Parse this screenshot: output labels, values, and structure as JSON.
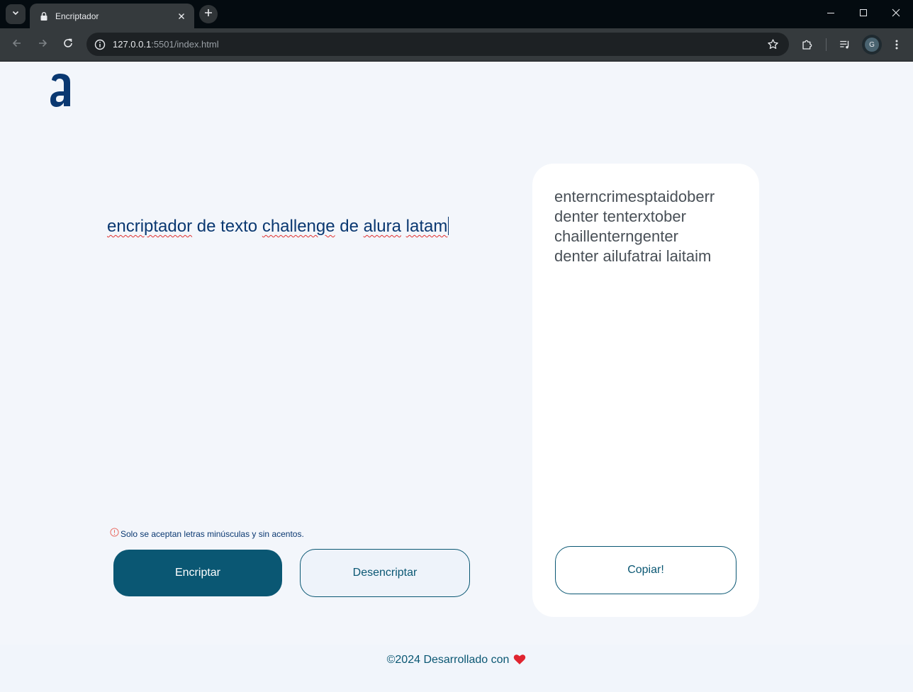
{
  "browser": {
    "tab_title": "Encriptador",
    "url_host": "127.0.0.1",
    "url_rest": ":5501/index.html",
    "avatar_letter": "G"
  },
  "page": {
    "logo_letter": "a",
    "input_words": [
      "encriptador",
      "de",
      "texto",
      "challenge",
      "de",
      "alura",
      "latam"
    ],
    "hint": "Solo se aceptan letras minúsculas y sin acentos.",
    "encrypt_label": "Encriptar",
    "decrypt_label": "Desencriptar",
    "result_lines": [
      "enterncrimesptaidoberr",
      "denter tenterxtober",
      "chaillenterngenter",
      "denter ailufatrai laitaim"
    ],
    "copy_label": "Copiar!",
    "footer_text": "©2024 Desarrollado con"
  },
  "icons": {
    "tab_search": "chevron-down-icon",
    "favicon": "lock-icon",
    "tab_close": "close-icon",
    "new_tab": "plus-icon",
    "minimize": "minimize-icon",
    "maximize": "maximize-icon",
    "close_window": "close-icon",
    "back": "arrow-left-icon",
    "forward": "arrow-right-icon",
    "reload": "reload-icon",
    "site_info": "info-icon",
    "bookmark": "star-icon",
    "extensions": "puzzle-icon",
    "media": "media-queue-icon",
    "menu": "kebab-menu-icon",
    "hint": "alert-circle-icon",
    "footer": "heart-icon"
  },
  "colors": {
    "primary": "#0a5773",
    "logo": "#0a3871",
    "page_bg": "#f3f6fb",
    "card_bg": "#ffffff",
    "heart": "#e0242f",
    "hint_icon": "#e8645a"
  }
}
